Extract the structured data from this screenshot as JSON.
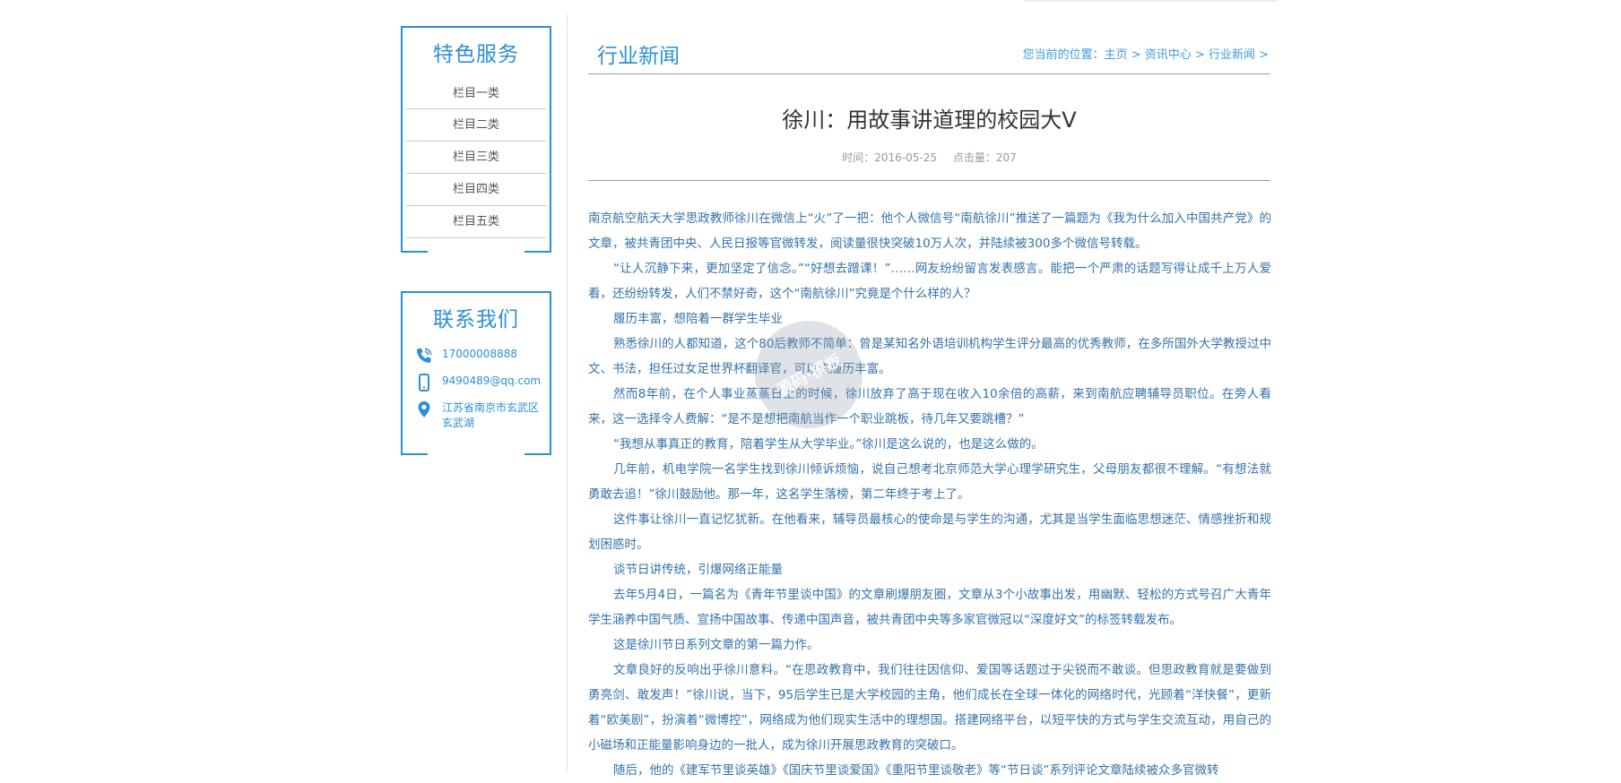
{
  "sidebar": {
    "services": {
      "title": "特色服务",
      "items": [
        "栏目一类",
        "栏目二类",
        "栏目三类",
        "栏目四类",
        "栏目五类"
      ]
    },
    "contact": {
      "title": "联系我们",
      "phone_icon": "phone-icon",
      "phone": "17000008888",
      "mobile_icon": "mobile-icon",
      "email": "9490489@qq.com",
      "location_icon": "location-pin-icon",
      "address": "江苏省南京市玄武区玄武湖"
    }
  },
  "main": {
    "section_title": "行业新闻",
    "breadcrumb": {
      "prefix": "您当前的位置：",
      "home": "主页",
      "sep": " > ",
      "news_center": "资讯中心",
      "industry_news": "行业新闻"
    },
    "article": {
      "title": "徐川：用故事讲道理的校园大V",
      "time_label": "时间：2016-05-25",
      "views_label": "点击量：207",
      "paragraphs": [
        "南京航空航天大学思政教师徐川在微信上“火”了一把：他个人微信号“南航徐川”推送了一篇题为《我为什么加入中国共产党》的文章，被共青团中央、人民日报等官微转发，阅读量很快突破10万人次，并陆续被300多个微信号转载。",
        "“让人沉静下来，更加坚定了信念。”“好想去蹭课！”……网友纷纷留言发表感言。能把一个严肃的话题写得让成千上万人爱看，还纷纷转发，人们不禁好奇，这个“南航徐川”究竟是个什么样的人？",
        "履历丰富，想陪着一群学生毕业",
        "熟悉徐川的人都知道，这个80后教师不简单：曾是某知名外语培训机构学生评分最高的优秀教师，在多所国外大学教授过中文、书法，担任过女足世界杯翻译官，可以说履历丰富。",
        "然而8年前，在个人事业蒸蒸日上的时候，徐川放弃了高于现在收入10余倍的高薪，来到南航应聘辅导员职位。在旁人看来，这一选择令人费解：“是不是想把南航当作一个职业跳板，待几年又要跳槽？”",
        "“我想从事真正的教育，陪着学生从大学毕业。”徐川是这么说的，也是这么做的。",
        "几年前，机电学院一名学生找到徐川倾诉烦恼，说自己想考北京师范大学心理学研究生，父母朋友都很不理解。“有想法就勇敢去追！”徐川鼓励他。那一年，这名学生落榜，第二年终于考上了。",
        "这件事让徐川一直记忆犹新。在他看来，辅导员最核心的使命是与学生的沟通，尤其是当学生面临思想迷茫、情感挫折和规划困惑时。",
        "谈节日讲传统，引爆网络正能量",
        "去年5月4日，一篇名为《青年节里谈中国》的文章刷爆朋友圈，文章从3个小故事出发，用幽默、轻松的方式号召广大青年学生涵养中国气质、宣扬中国故事、传递中国声音，被共青团中央等多家官微冠以“深度好文”的标签转载发布。",
        "这是徐川节日系列文章的第一篇力作。",
        "文章良好的反响出乎徐川意料。“在思政教育中，我们往往因信仰、爱国等话题过于尖锐而不敢谈。但思政教育就是要做到勇亮剑、敢发声！”徐川说，当下，95后学生已是大学校园的主角，他们成长在全球一体化的网络时代，光顾着“洋快餐”，更新着“欧美剧”，扮演着“微博控”，网络成为他们现实生活中的理想国。搭建网络平台，以短平快的方式与学生交流互动，用自己的小磁场和正能量影响身边的一批人，成为徐川开展思政教育的突破口。",
        "随后，他的《建军节里谈英雄》《国庆节里谈爱国》《重阳节里谈敬老》等“节日谈”系列评论文章陆续被众多官微转"
      ]
    }
  },
  "watermark": {
    "text": "源码·模板"
  }
}
